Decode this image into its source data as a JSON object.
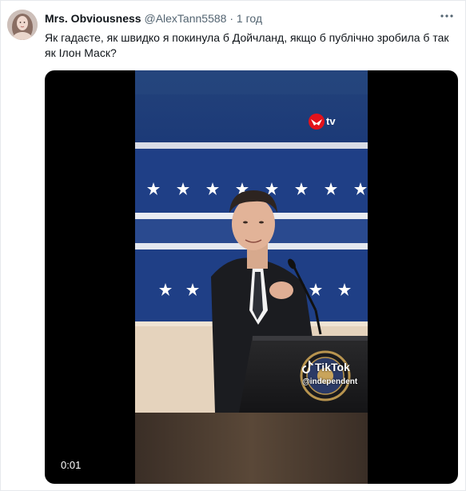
{
  "tweet": {
    "author_name": "Mrs. Obviousness",
    "author_handle": "@AlexTann5588",
    "separator": "·",
    "time": "1 год",
    "text": "Як гадаєте, як швидко я покинула б Дойчланд, якщо б публічно зробила б так як Ілон Маск?"
  },
  "video": {
    "timestamp": "0:01",
    "channel_logo_text": "tv",
    "tiktok_brand": "TikTok",
    "tiktok_handle": "@independent"
  },
  "icons": {
    "avatar": "profile-avatar",
    "more": "more-options-icon",
    "channel": "independent-eagle-logo",
    "tiktok": "tiktok-note-icon"
  },
  "colors": {
    "name": "#0f1419",
    "secondary": "#536471",
    "stage_blue": "#1e3f86",
    "logo_red": "#e3121b"
  }
}
